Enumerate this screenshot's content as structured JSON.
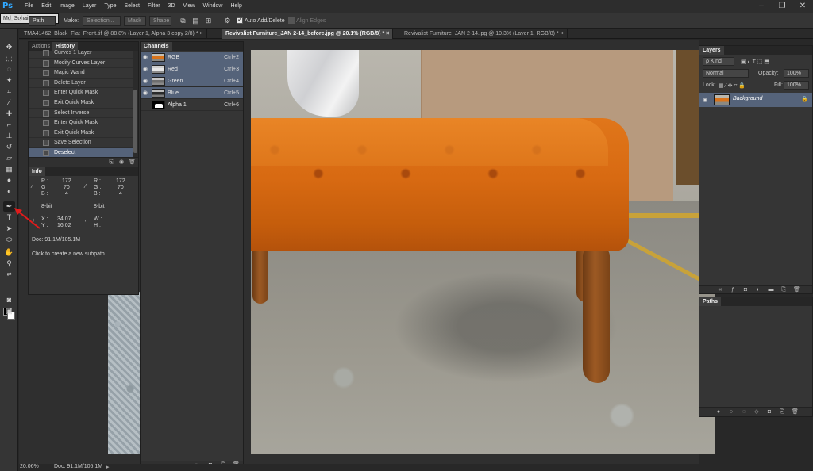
{
  "app": {
    "logo": "Ps"
  },
  "menu": [
    "File",
    "Edit",
    "Image",
    "Layer",
    "Type",
    "Select",
    "Filter",
    "3D",
    "View",
    "Window",
    "Help"
  ],
  "window_controls": [
    "–",
    "❐",
    "✕"
  ],
  "options_bar": {
    "mode": "Path",
    "make_label": "Make:",
    "selection_btn": "Selection...",
    "mask_btn": "Mask",
    "shape_btn": "Shape",
    "auto_add_delete": "Auto Add/Delete",
    "align_edges": "Align Edges",
    "workspace": "Md_Suhail"
  },
  "doc_tabs": [
    "TMA41462_Black_Flat_Front.tif @ 88.8% (Layer 1, Alpha 3 copy 2/8) * ×",
    "Revivalist Furniture_JAN 2-14_before.jpg @ 20.1% (RGB/8) * ×",
    "Revivalist Furniture_JAN 2-14.jpg @ 10.3% (Layer 1, RGB/8) * ×"
  ],
  "history_panel": {
    "tabs": [
      "Actions",
      "History"
    ],
    "items": [
      "Curves 1 Layer",
      "Modify Curves Layer",
      "Magic Wand",
      "Delete Layer",
      "Enter Quick Mask",
      "Exit Quick Mask",
      "Select Inverse",
      "Enter Quick Mask",
      "Exit Quick Mask",
      "Save Selection",
      "Deselect"
    ]
  },
  "info_panel": {
    "title": "Info",
    "r_label": "R :",
    "g_label": "G :",
    "b_label": "B :",
    "r1": "172",
    "g1": "70",
    "b1": "4",
    "r2": "172",
    "g2": "70",
    "b2": "4",
    "bit1": "8-bit",
    "bit2": "8-bit",
    "x_label": "X :",
    "y_label": "Y :",
    "x": "34.07",
    "y": "16.02",
    "w_label": "W :",
    "h_label": "H :",
    "doc": "Doc: 91.1M/105.1M",
    "hint": "Click to create a new subpath."
  },
  "channels_panel": {
    "title": "Channels",
    "items": [
      {
        "name": "RGB",
        "key": "Ctrl+2"
      },
      {
        "name": "Red",
        "key": "Ctrl+3"
      },
      {
        "name": "Green",
        "key": "Ctrl+4"
      },
      {
        "name": "Blue",
        "key": "Ctrl+5"
      },
      {
        "name": "Alpha 1",
        "key": "Ctrl+6"
      }
    ]
  },
  "layers_panel": {
    "title": "Layers",
    "kind": "ρ Kind",
    "blend": "Normal",
    "opacity_label": "Opacity:",
    "opacity": "100%",
    "lock_label": "Lock:",
    "fill_label": "Fill:",
    "fill": "100%",
    "layer_name": "Background"
  },
  "paths_panel": {
    "title": "Paths"
  },
  "status": {
    "zoom": "20.06%",
    "doc": "Doc: 91.1M/105.1M"
  },
  "colors": {
    "selection_blue": "#55637a",
    "panel_bg": "#353535",
    "accent": "#31a8ff"
  }
}
